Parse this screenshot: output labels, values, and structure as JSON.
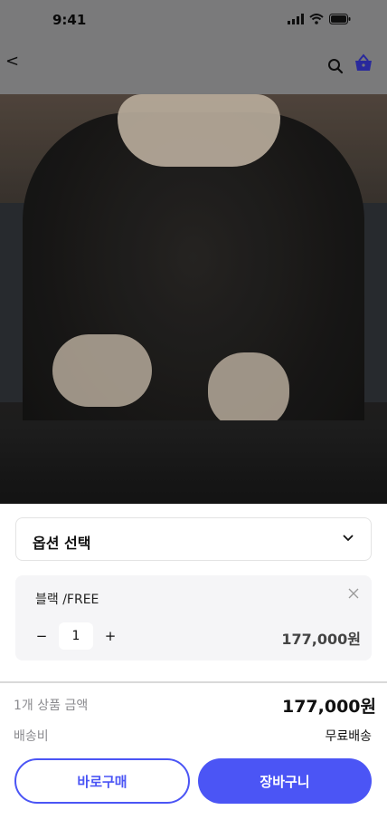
{
  "status": {
    "time": "9:41"
  },
  "header": {
    "back_label": "<",
    "icons": [
      "search-icon",
      "basket-icon"
    ],
    "accent": "#4b55f5"
  },
  "product_image": {
    "alt": ""
  },
  "option": {
    "placeholder": "옵션 선택"
  },
  "selected_item": {
    "name": "블랙 /FREE",
    "quantity": "1",
    "price": "177,000원",
    "minus": "−",
    "plus": "+"
  },
  "summary": {
    "total_label": "1개 상품 금액",
    "total_value": "177,000원",
    "shipping_label": "배송비",
    "shipping_value": "무료배송"
  },
  "actions": {
    "buy_now": "바로구매",
    "add_to_cart": "장바구니"
  },
  "colors": {
    "primary": "#4b55f5",
    "overlay": "#8b8b8d"
  }
}
